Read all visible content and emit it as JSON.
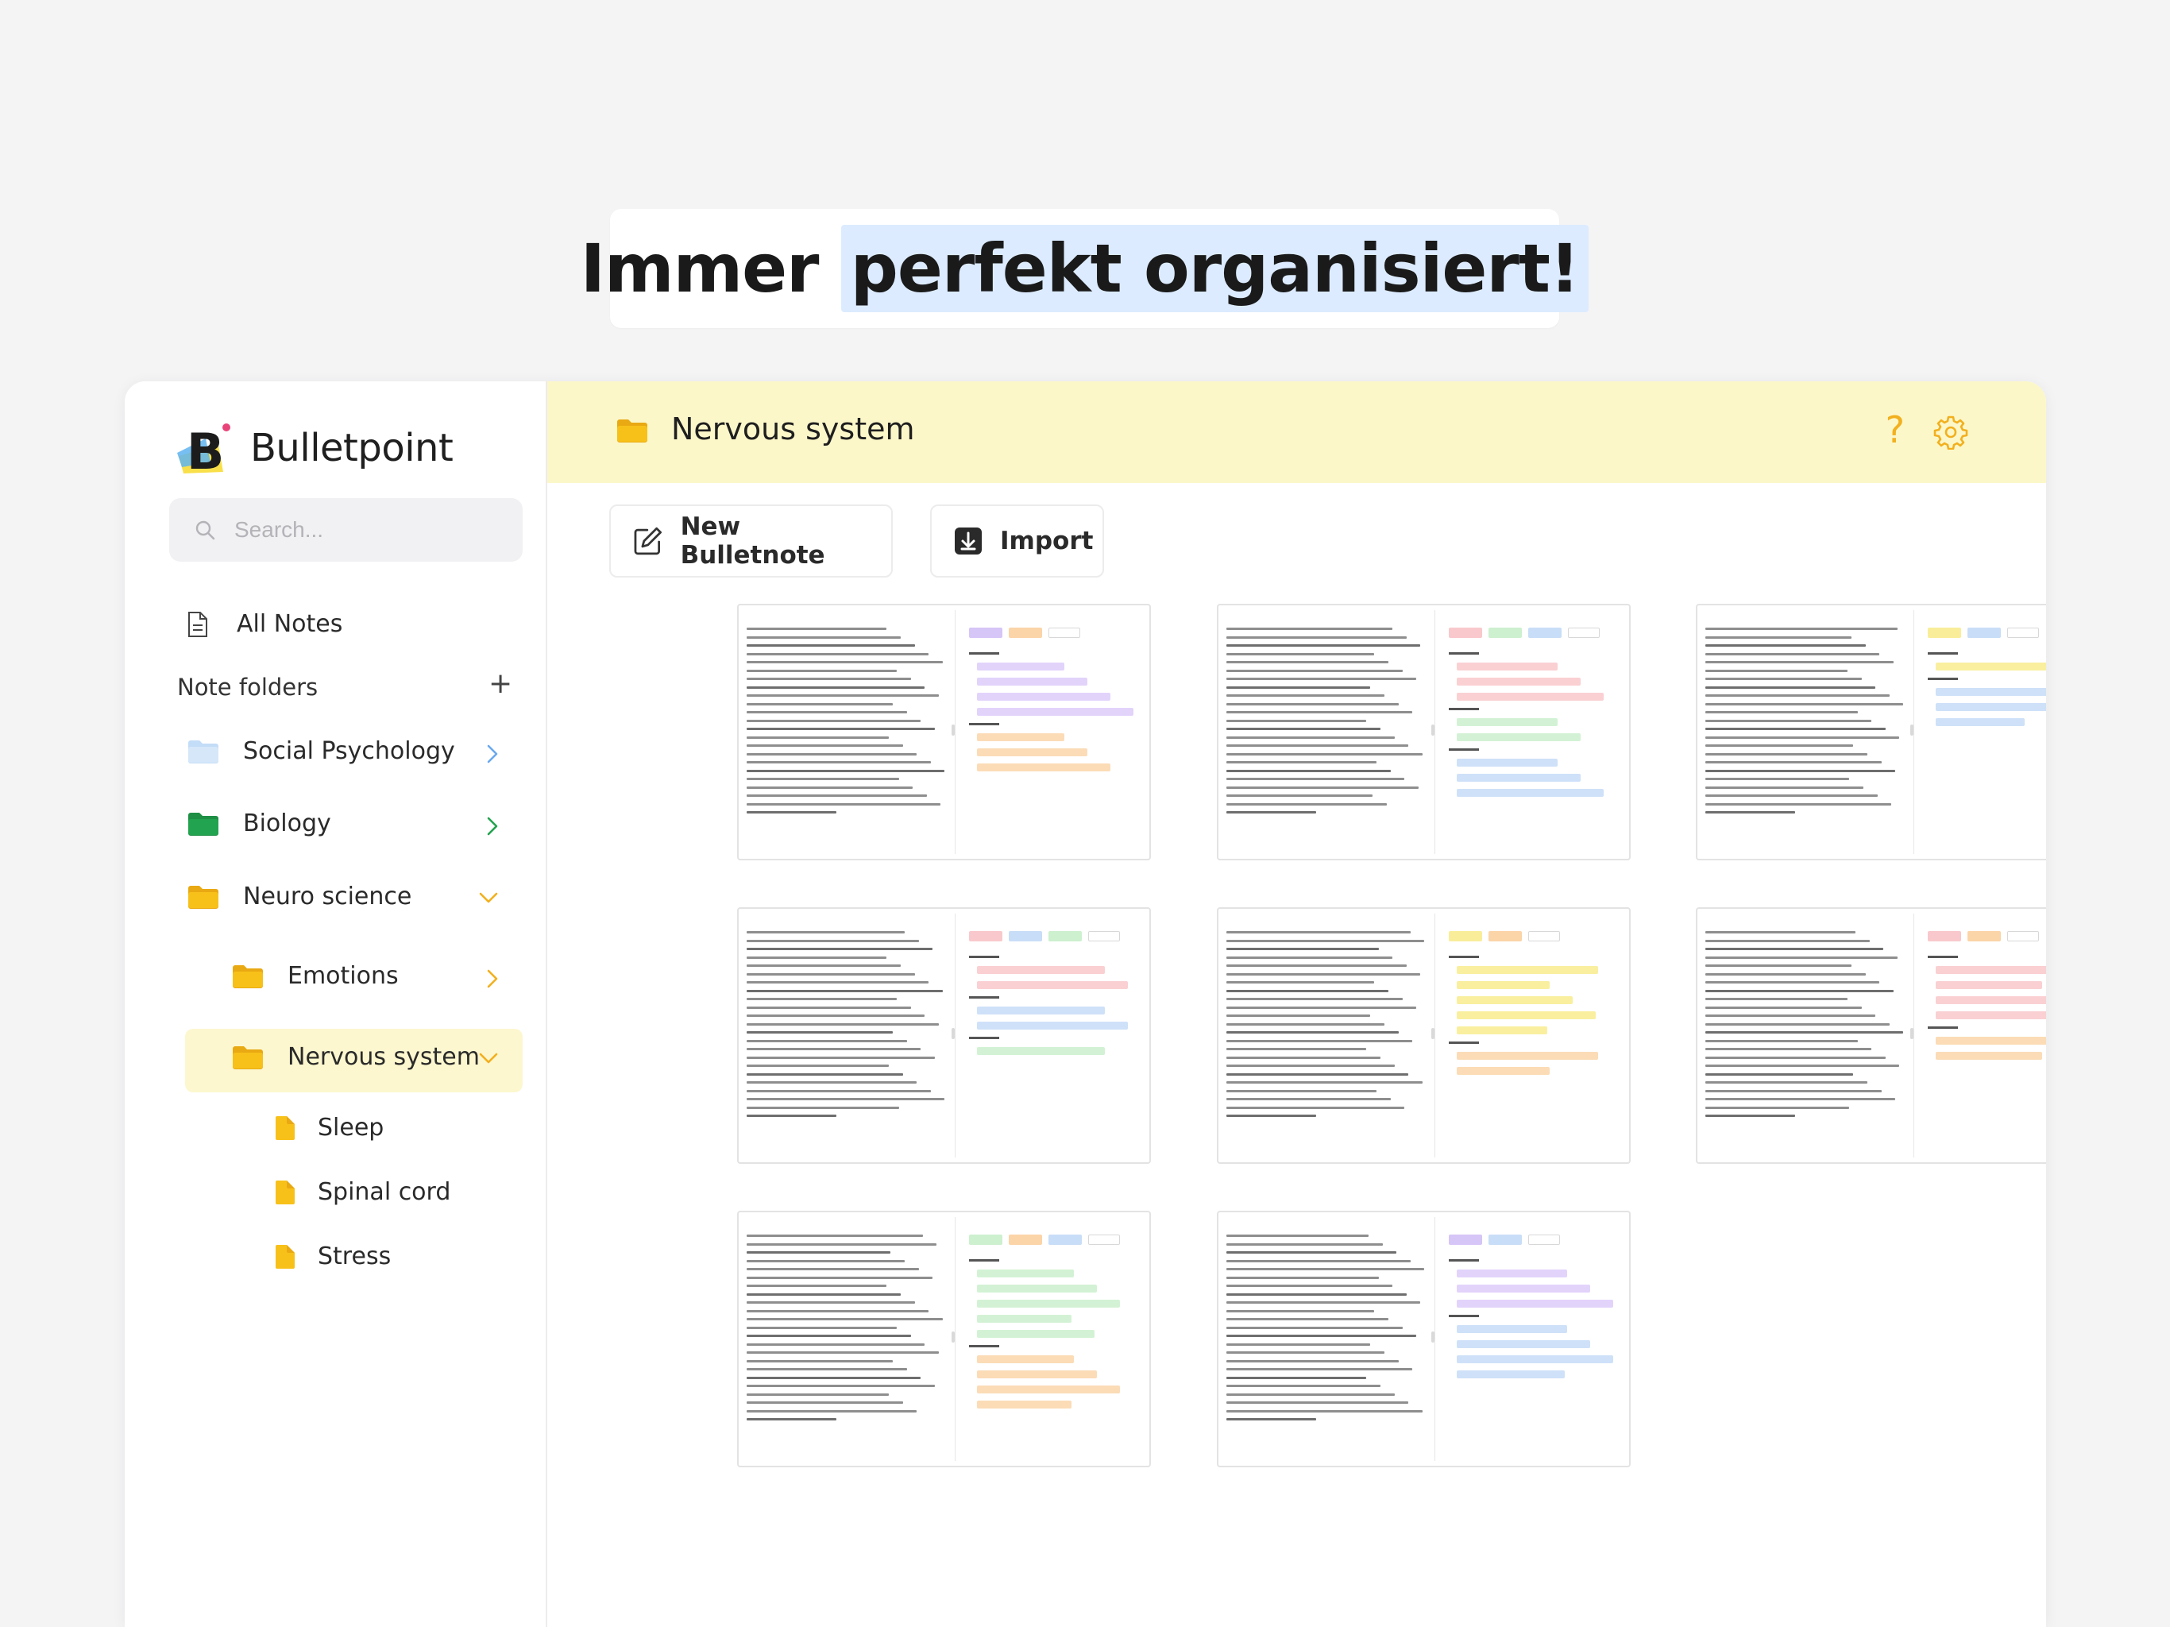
{
  "headline": {
    "prefix": "Immer ",
    "highlight": "perfekt organisiert!"
  },
  "app": {
    "name": "Bulletpoint",
    "logo_letter": "B"
  },
  "search": {
    "placeholder": "Search..."
  },
  "sidebar": {
    "all_notes": "All Notes",
    "folders_title": "Note folders",
    "add_folder": "+",
    "folders": [
      {
        "label": "Social Psychology",
        "color": "#c3dcf7",
        "state": "collapsed"
      },
      {
        "label": "Biology",
        "color": "#22a34f",
        "state": "collapsed"
      },
      {
        "label": "Neuro science",
        "color": "#f7c11a",
        "state": "expanded"
      },
      {
        "label": "Emotions",
        "color": "#f7c11a",
        "state": "collapsed"
      },
      {
        "label": "Nervous system",
        "color": "#f7c11a",
        "state": "expanded",
        "selected": true
      }
    ],
    "notes": [
      "Sleep",
      "Spinal cord",
      "Stress"
    ]
  },
  "header": {
    "title": "Nervous system",
    "help": "?"
  },
  "toolbar": {
    "new_label": "New Bulletnote",
    "import_label": "Import"
  },
  "colors": {
    "accent_yellow": "#f7c11a",
    "header_bg": "#fcf7c9",
    "highlight_blue": "#dcebff"
  },
  "cards": [
    {
      "tags": [
        "#d6c5f7",
        "#fbd4a8",
        "empty"
      ],
      "sections": [
        {
          "items": [
            "#e2d3fb",
            "#e2d3fb",
            "#e2d3fb",
            "#e2d3fb"
          ]
        },
        {
          "items": [
            "#fbdcb7",
            "#fbdcb7",
            "#fbdcb7"
          ]
        }
      ]
    },
    {
      "tags": [
        "#f9c8cc",
        "#cdf0cf",
        "#c8ddf7",
        "empty"
      ],
      "sections": [
        {
          "items": [
            "#fad0d3",
            "#fad0d3",
            "#fad0d3"
          ]
        },
        {
          "items": [
            "#d3f2d5",
            "#d3f2d5"
          ]
        },
        {
          "items": [
            "#cfe1f9",
            "#cfe1f9",
            "#cfe1f9"
          ]
        }
      ]
    },
    {
      "tags": [
        "#f9ed9a",
        "#c8ddf7",
        "empty"
      ],
      "sections": [
        {
          "items": [
            "#f9ef9f"
          ]
        },
        {
          "items": [
            "#cfe1f9",
            "#cfe1f9",
            "#cfe1f9"
          ]
        }
      ]
    },
    {
      "tags": [
        "#f9c8cc",
        "#c8ddf7",
        "#cdf0cf",
        "empty"
      ],
      "sections": [
        {
          "items": [
            "#fad0d3",
            "#fad0d3"
          ]
        },
        {
          "items": [
            "#cfe1f9",
            "#cfe1f9"
          ]
        },
        {
          "items": [
            "#d3f2d5"
          ]
        }
      ]
    },
    {
      "tags": [
        "#f9ed9a",
        "#fbd4a8",
        "empty"
      ],
      "sections": [
        {
          "items": [
            "#f9ef9f",
            "#f9ef9f",
            "#f9ef9f",
            "#f9ef9f",
            "#f9ef9f"
          ]
        },
        {
          "items": [
            "#fbdcb7",
            "#fbdcb7"
          ]
        }
      ]
    },
    {
      "tags": [
        "#f9c8cc",
        "#fbd4a8",
        "empty"
      ],
      "sections": [
        {
          "items": [
            "#fad0d3",
            "#fad0d3",
            "#fad0d3",
            "#fad0d3"
          ]
        },
        {
          "items": [
            "#fbdcb7",
            "#fbdcb7"
          ]
        }
      ]
    },
    {
      "tags": [
        "#cdf0cf",
        "#fbd4a8",
        "#c8ddf7",
        "empty"
      ],
      "sections": [
        {
          "items": [
            "#d3f2d5",
            "#d3f2d5",
            "#d3f2d5",
            "#d3f2d5",
            "#d3f2d5"
          ]
        },
        {
          "items": [
            "#fbdcb7",
            "#fbdcb7",
            "#fbdcb7",
            "#fbdcb7"
          ]
        }
      ]
    },
    {
      "tags": [
        "#d6c5f7",
        "#c8ddf7",
        "empty"
      ],
      "sections": [
        {
          "items": [
            "#e2d3fb",
            "#e2d3fb",
            "#e2d3fb"
          ]
        },
        {
          "items": [
            "#cfe1f9",
            "#cfe1f9",
            "#cfe1f9",
            "#cfe1f9"
          ]
        }
      ]
    }
  ]
}
